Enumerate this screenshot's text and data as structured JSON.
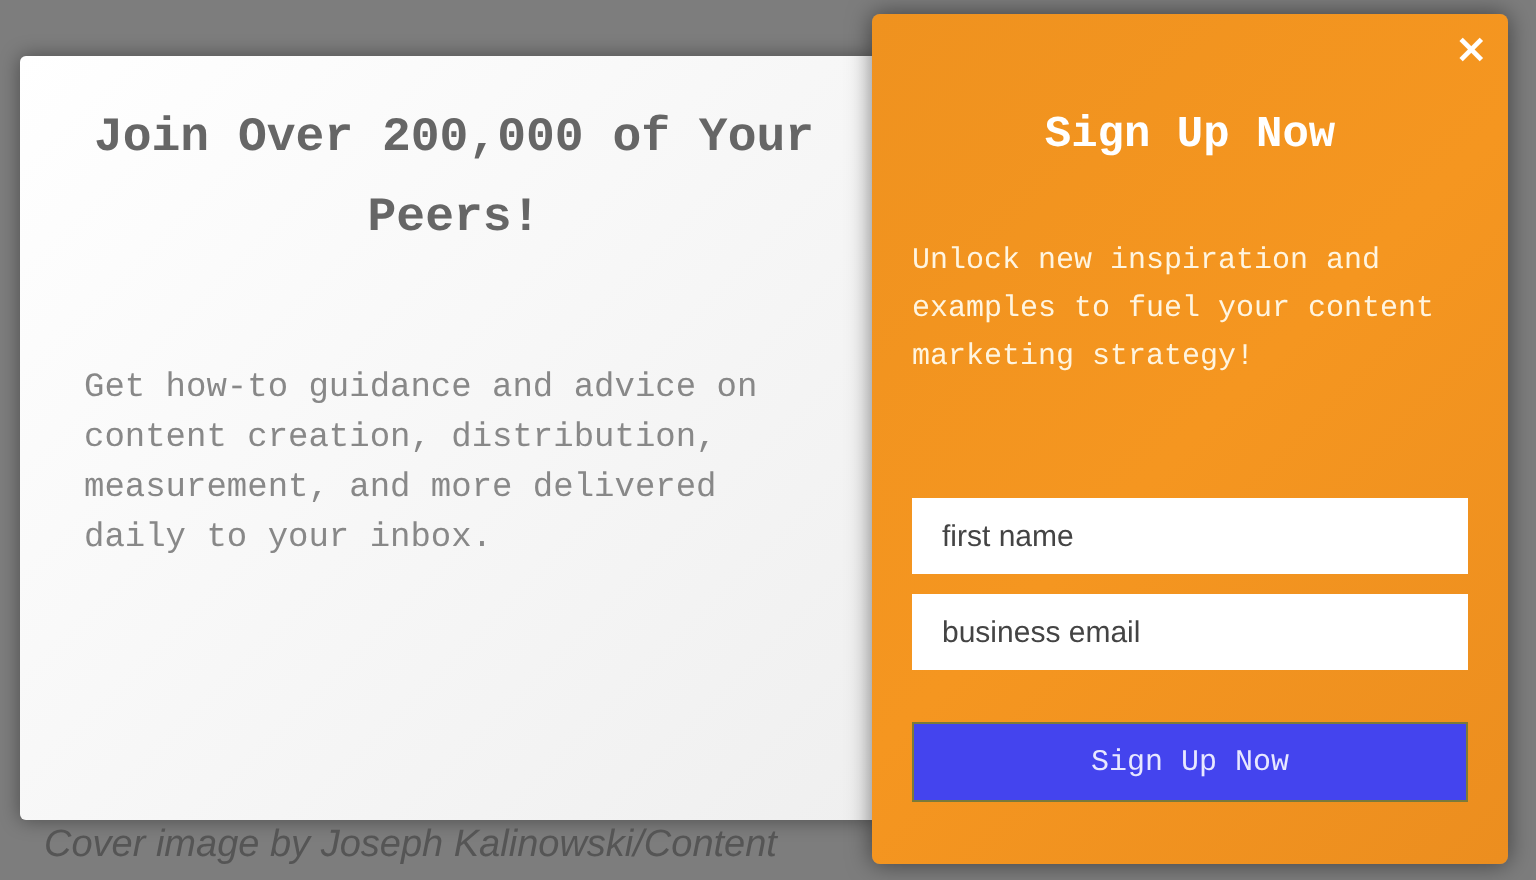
{
  "promo": {
    "heading": "Join Over 200,000 of Your Peers!",
    "body": "Get how-to guidance and advice on content creation, distribution, measurement, and more delivered daily to your inbox.",
    "caption": "Cover image by Joseph Kalinowski/Content"
  },
  "signup": {
    "close": "×",
    "title": "Sign Up Now",
    "text": "Unlock new inspiration and examples to fuel your content marketing strategy!",
    "fields": [
      {
        "placeholder": "first name"
      },
      {
        "placeholder": "business email"
      }
    ],
    "button": "Sign Up Now"
  }
}
